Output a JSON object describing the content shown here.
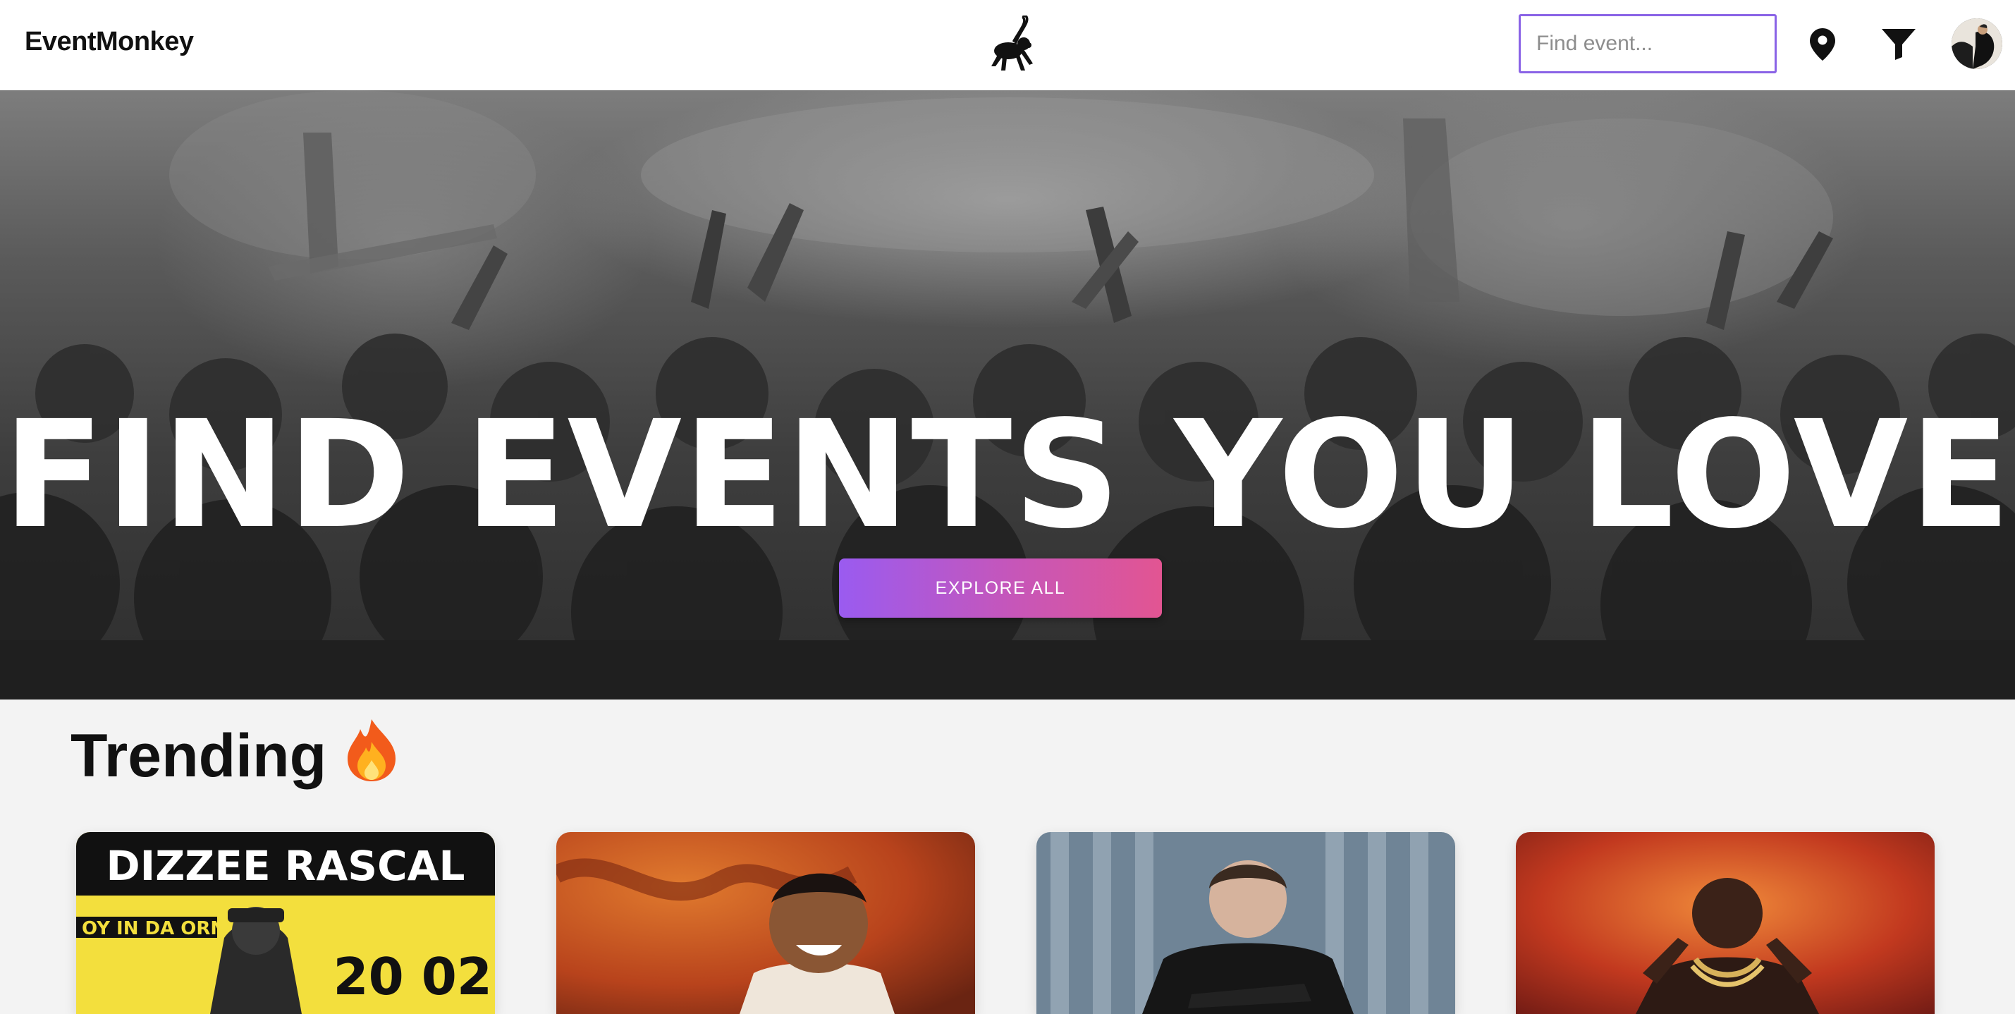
{
  "header": {
    "brand": "EventMonkey",
    "search": {
      "placeholder": "Find event...",
      "value": ""
    },
    "icons": [
      "monkey-logo-icon",
      "location-pin-icon",
      "filter-icon",
      "user-avatar"
    ]
  },
  "hero": {
    "title": "FIND EVENTS YOU LOVE",
    "cta_label": "EXPLORE ALL"
  },
  "trending": {
    "title": "Trending",
    "emoji": "fire-icon",
    "cards": [
      {
        "image": "dizzee-rascal-poster",
        "poster_title": "DIZZEE RASCAL",
        "poster_line": "OY IN DA ORNER",
        "poster_year": "20 02"
      },
      {
        "image": "smiling-artist-photo"
      },
      {
        "image": "artist-arms-crossed-photo"
      },
      {
        "image": "artist-gold-chain-photo"
      }
    ]
  },
  "colors": {
    "accent_border": "#8a63e6",
    "cta_gradient_start": "#9a5bf0",
    "cta_gradient_end": "#e25592",
    "page_background": "#f3f3f3"
  }
}
